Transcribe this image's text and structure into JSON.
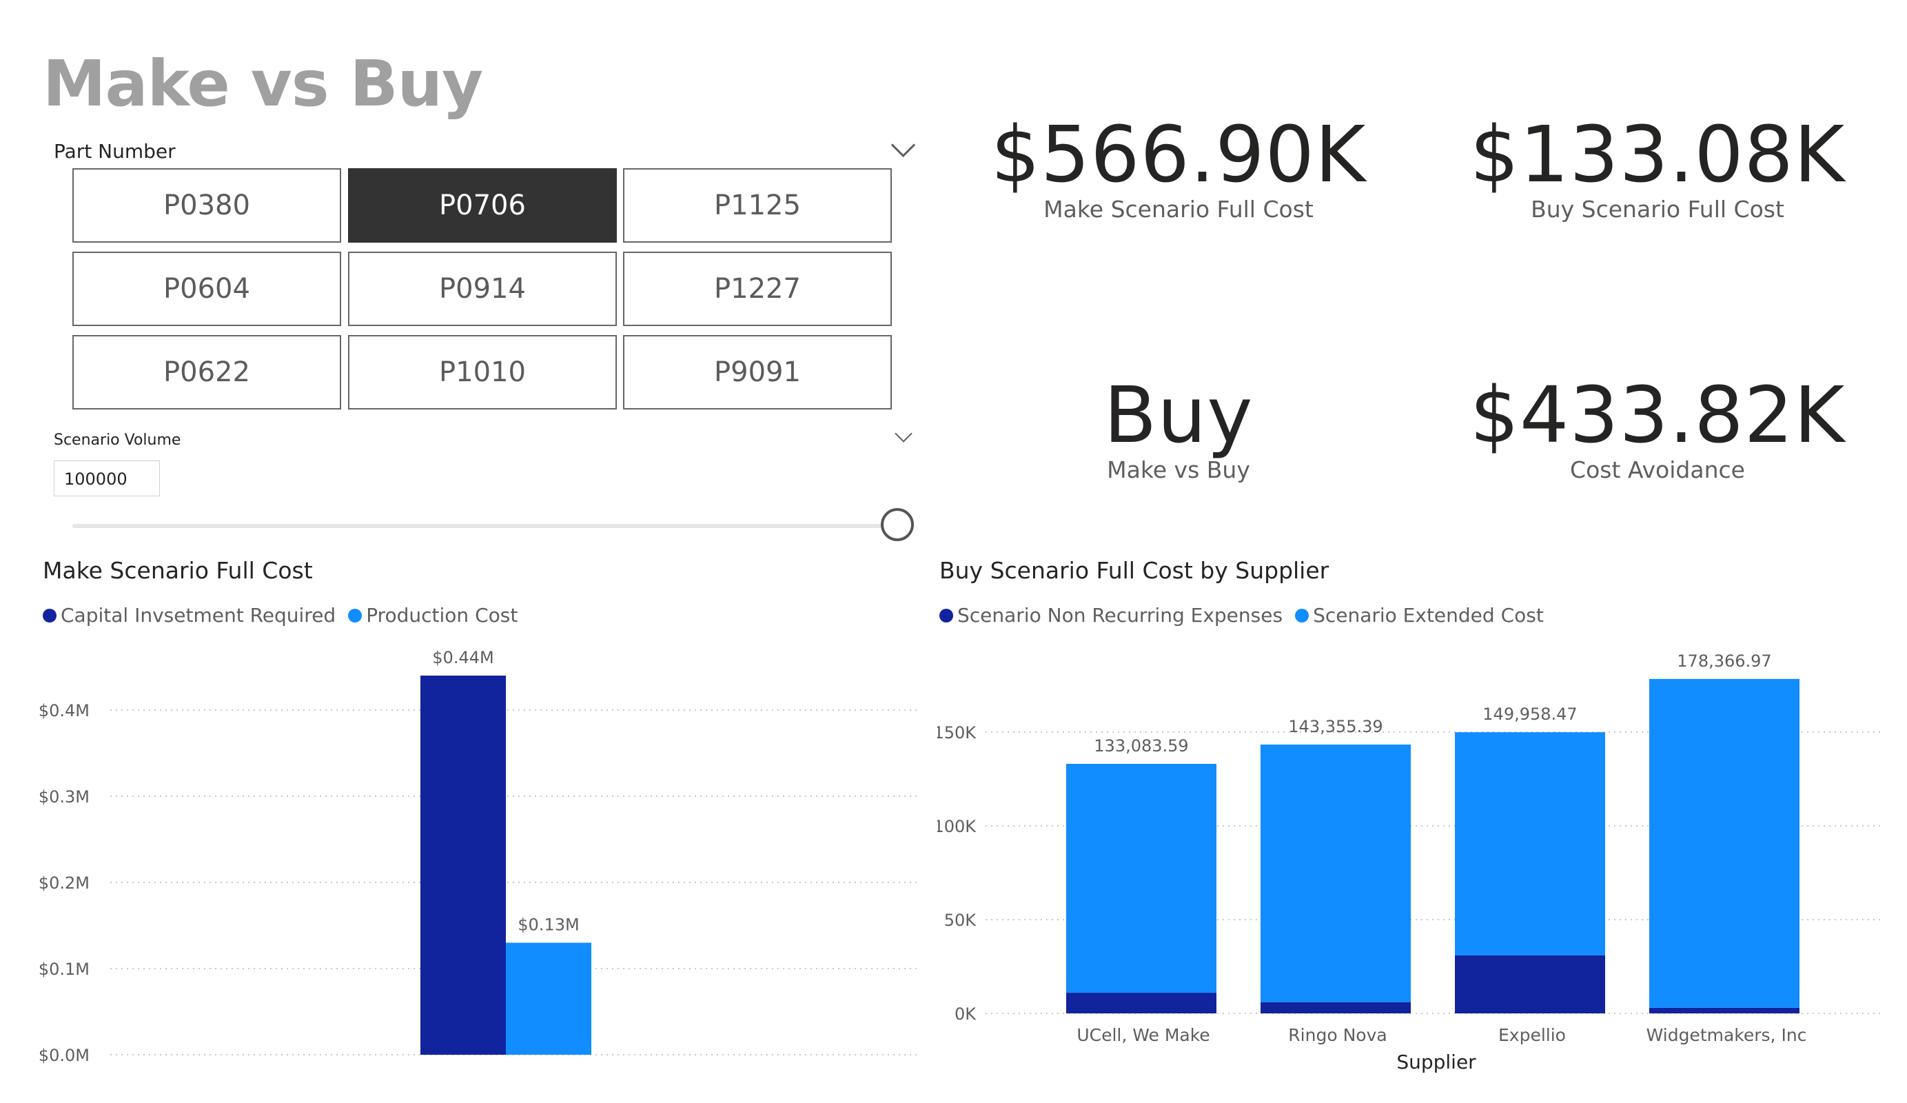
{
  "header": {
    "title": "Make vs Buy"
  },
  "part_slicer": {
    "title": "Part Number",
    "selected": "P0706",
    "parts": [
      "P0380",
      "P0706",
      "P1125",
      "P0604",
      "P0914",
      "P1227",
      "P0622",
      "P1010",
      "P9091"
    ]
  },
  "volume_slicer": {
    "title": "Scenario Volume",
    "value": "100000",
    "slider_fraction": 1.0
  },
  "kpis": {
    "make_full_cost": {
      "value": "$566.90K",
      "label": "Make Scenario Full Cost"
    },
    "buy_full_cost": {
      "value": "$133.08K",
      "label": "Buy Scenario Full Cost"
    },
    "decision": {
      "value": "Buy",
      "label": "Make vs Buy"
    },
    "cost_avoidance": {
      "value": "$433.82K",
      "label": "Cost Avoidance"
    }
  },
  "colors": {
    "dark_blue": "#12239e",
    "light_blue": "#118dff",
    "selected_tile": "#333333"
  },
  "chart_data": [
    {
      "type": "bar",
      "title": "Make Scenario Full Cost",
      "categories": [
        ""
      ],
      "series": [
        {
          "name": "Capital Invsetment Required",
          "values": [
            0.44
          ],
          "label": "$0.44M",
          "color": "#12239e"
        },
        {
          "name": "Production Cost",
          "values": [
            0.13
          ],
          "label": "$0.13M",
          "color": "#118dff"
        }
      ],
      "ylim": [
        0,
        0.4
      ],
      "yticks": [
        0,
        0.1,
        0.2,
        0.3,
        0.4
      ],
      "ytick_labels": [
        "$0.0M",
        "$0.1M",
        "$0.2M",
        "$0.3M",
        "$0.4M"
      ],
      "grid": true,
      "legend": "top-left"
    },
    {
      "type": "bar",
      "stacked": true,
      "title": "Buy Scenario Full Cost by Supplier",
      "xlabel": "Supplier",
      "categories": [
        "UCell, We Make",
        "Ringo Nova",
        "Expellio",
        "Widgetmakers, Inc"
      ],
      "series": [
        {
          "name": "Scenario Non Recurring Expenses",
          "values": [
            11000,
            6000,
            31000,
            3000
          ],
          "color": "#12239e"
        },
        {
          "name": "Scenario Extended Cost",
          "values": [
            122083.59,
            137355.39,
            118958.47,
            175366.97
          ],
          "color": "#118dff"
        }
      ],
      "totals": [
        "133,083.59",
        "143,355.39",
        "149,958.47",
        "178,366.97"
      ],
      "yticks": [
        0,
        50000,
        100000,
        150000
      ],
      "ytick_labels": [
        "0K",
        "50K",
        "100K",
        "150K"
      ],
      "grid": true,
      "legend": "top-left"
    }
  ]
}
